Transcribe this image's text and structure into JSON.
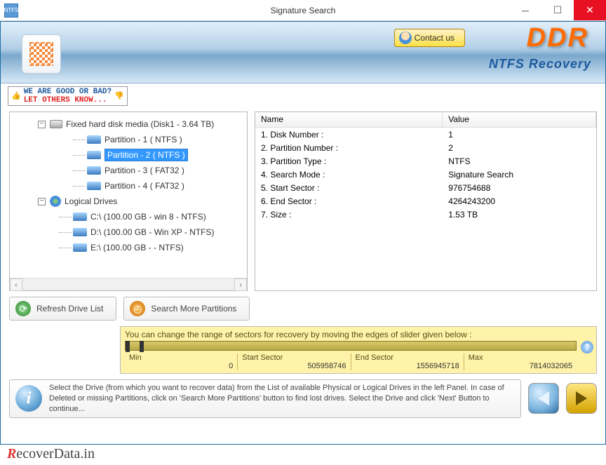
{
  "window": {
    "title": "Signature Search"
  },
  "header": {
    "contact": "Contact us",
    "brand": "DDR",
    "product": "NTFS Recovery"
  },
  "feedback": {
    "line1": "WE ARE GOOD OR BAD?",
    "line2": "LET OTHERS KNOW..."
  },
  "tree": {
    "fixed_label": "Fixed hard disk media (Disk1 - 3.64 TB)",
    "partitions": [
      "Partition - 1 ( NTFS )",
      "Partition - 2 ( NTFS )",
      "Partition - 3 ( FAT32 )",
      "Partition - 4 ( FAT32 )"
    ],
    "selected_index": 1,
    "logical_label": "Logical Drives",
    "logical": [
      "C:\\ (100.00 GB - win 8 - NTFS)",
      "D:\\ (100.00 GB - Win XP - NTFS)",
      "E:\\ (100.00 GB -  - NTFS)"
    ]
  },
  "table": {
    "headers": {
      "name": "Name",
      "value": "Value"
    },
    "rows": [
      {
        "name": "1. Disk Number :",
        "value": "1"
      },
      {
        "name": "2. Partition Number :",
        "value": "2"
      },
      {
        "name": "3. Partition Type :",
        "value": "NTFS"
      },
      {
        "name": "4. Search Mode :",
        "value": "Signature Search"
      },
      {
        "name": "5. Start Sector :",
        "value": "976754688"
      },
      {
        "name": "6. End Sector :",
        "value": "4264243200"
      },
      {
        "name": "7. Size :",
        "value": "1.53 TB"
      }
    ]
  },
  "buttons": {
    "refresh": "Refresh Drive List",
    "search_more": "Search More Partitions"
  },
  "sector": {
    "hint": "You can change the range of sectors for recovery by moving the edges of slider given below :",
    "min_label": "Min",
    "min": "0",
    "start_label": "Start Sector",
    "start": "505958746",
    "end_label": "End Sector",
    "end": "1556945718",
    "max_label": "Max",
    "max": "7814032065"
  },
  "info_text": "Select the Drive (from which you want to recover data) from the List of available Physical or Logical Drives in the left Panel. In case of Deleted or missing Partitions, click on 'Search More Partitions' button to find lost drives. Select the Drive and click 'Next' Button to continue...",
  "footer": {
    "r": "R",
    "rest": "ecoverData.in"
  }
}
